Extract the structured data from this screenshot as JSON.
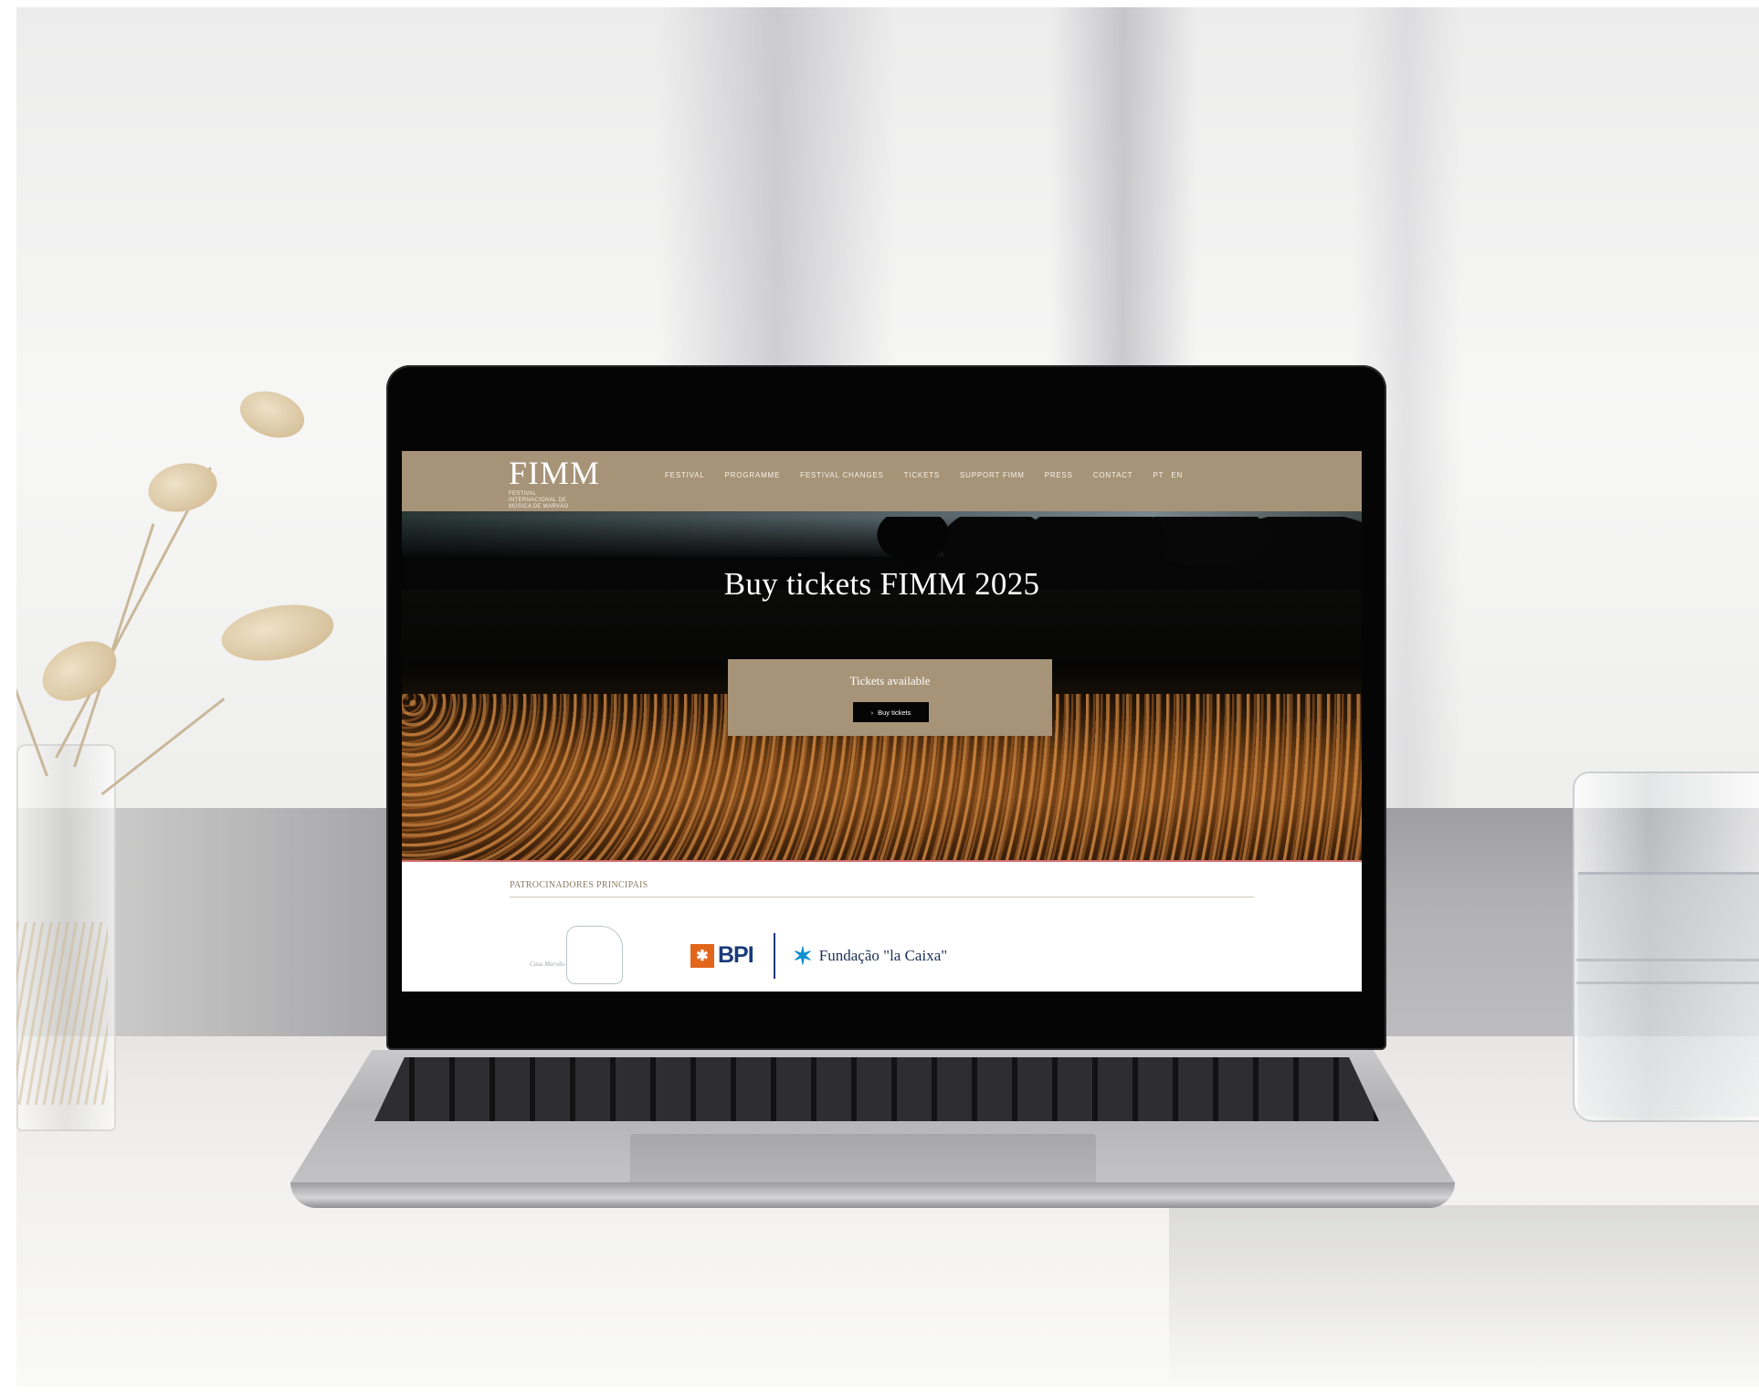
{
  "site": {
    "logo": "FIMM",
    "logo_sub": "FESTIVAL INTERNACIONAL DE MÚSICA DE MARVÃO"
  },
  "nav": {
    "items": [
      "FESTIVAL",
      "PROGRAMME",
      "FESTIVAL CHANGES",
      "TICKETS",
      "SUPPORT FIMM",
      "PRESS",
      "CONTACT"
    ],
    "lang": [
      "PT",
      "EN"
    ]
  },
  "hero": {
    "title": "Buy tickets FIMM 2025",
    "ticket_label": "Tickets available",
    "buy_button": "Buy tickets",
    "buy_icon": "chevron-right-icon"
  },
  "sponsors": {
    "heading": "PATROCINADORES PRINCIPAIS",
    "items": [
      {
        "name": "sponsor-logo-1",
        "text": "Casa Marvão"
      },
      {
        "name": "bpi",
        "text": "BPI"
      },
      {
        "name": "fundacao-la-caixa",
        "text": "Fundação \"la Caixa\""
      }
    ]
  },
  "colors": {
    "brand_taupe": "#a79478",
    "button_black": "#050505",
    "bpi_orange": "#e2661a",
    "bpi_blue": "#1a3a7a",
    "caixa_blue": "#0b8fd1"
  }
}
